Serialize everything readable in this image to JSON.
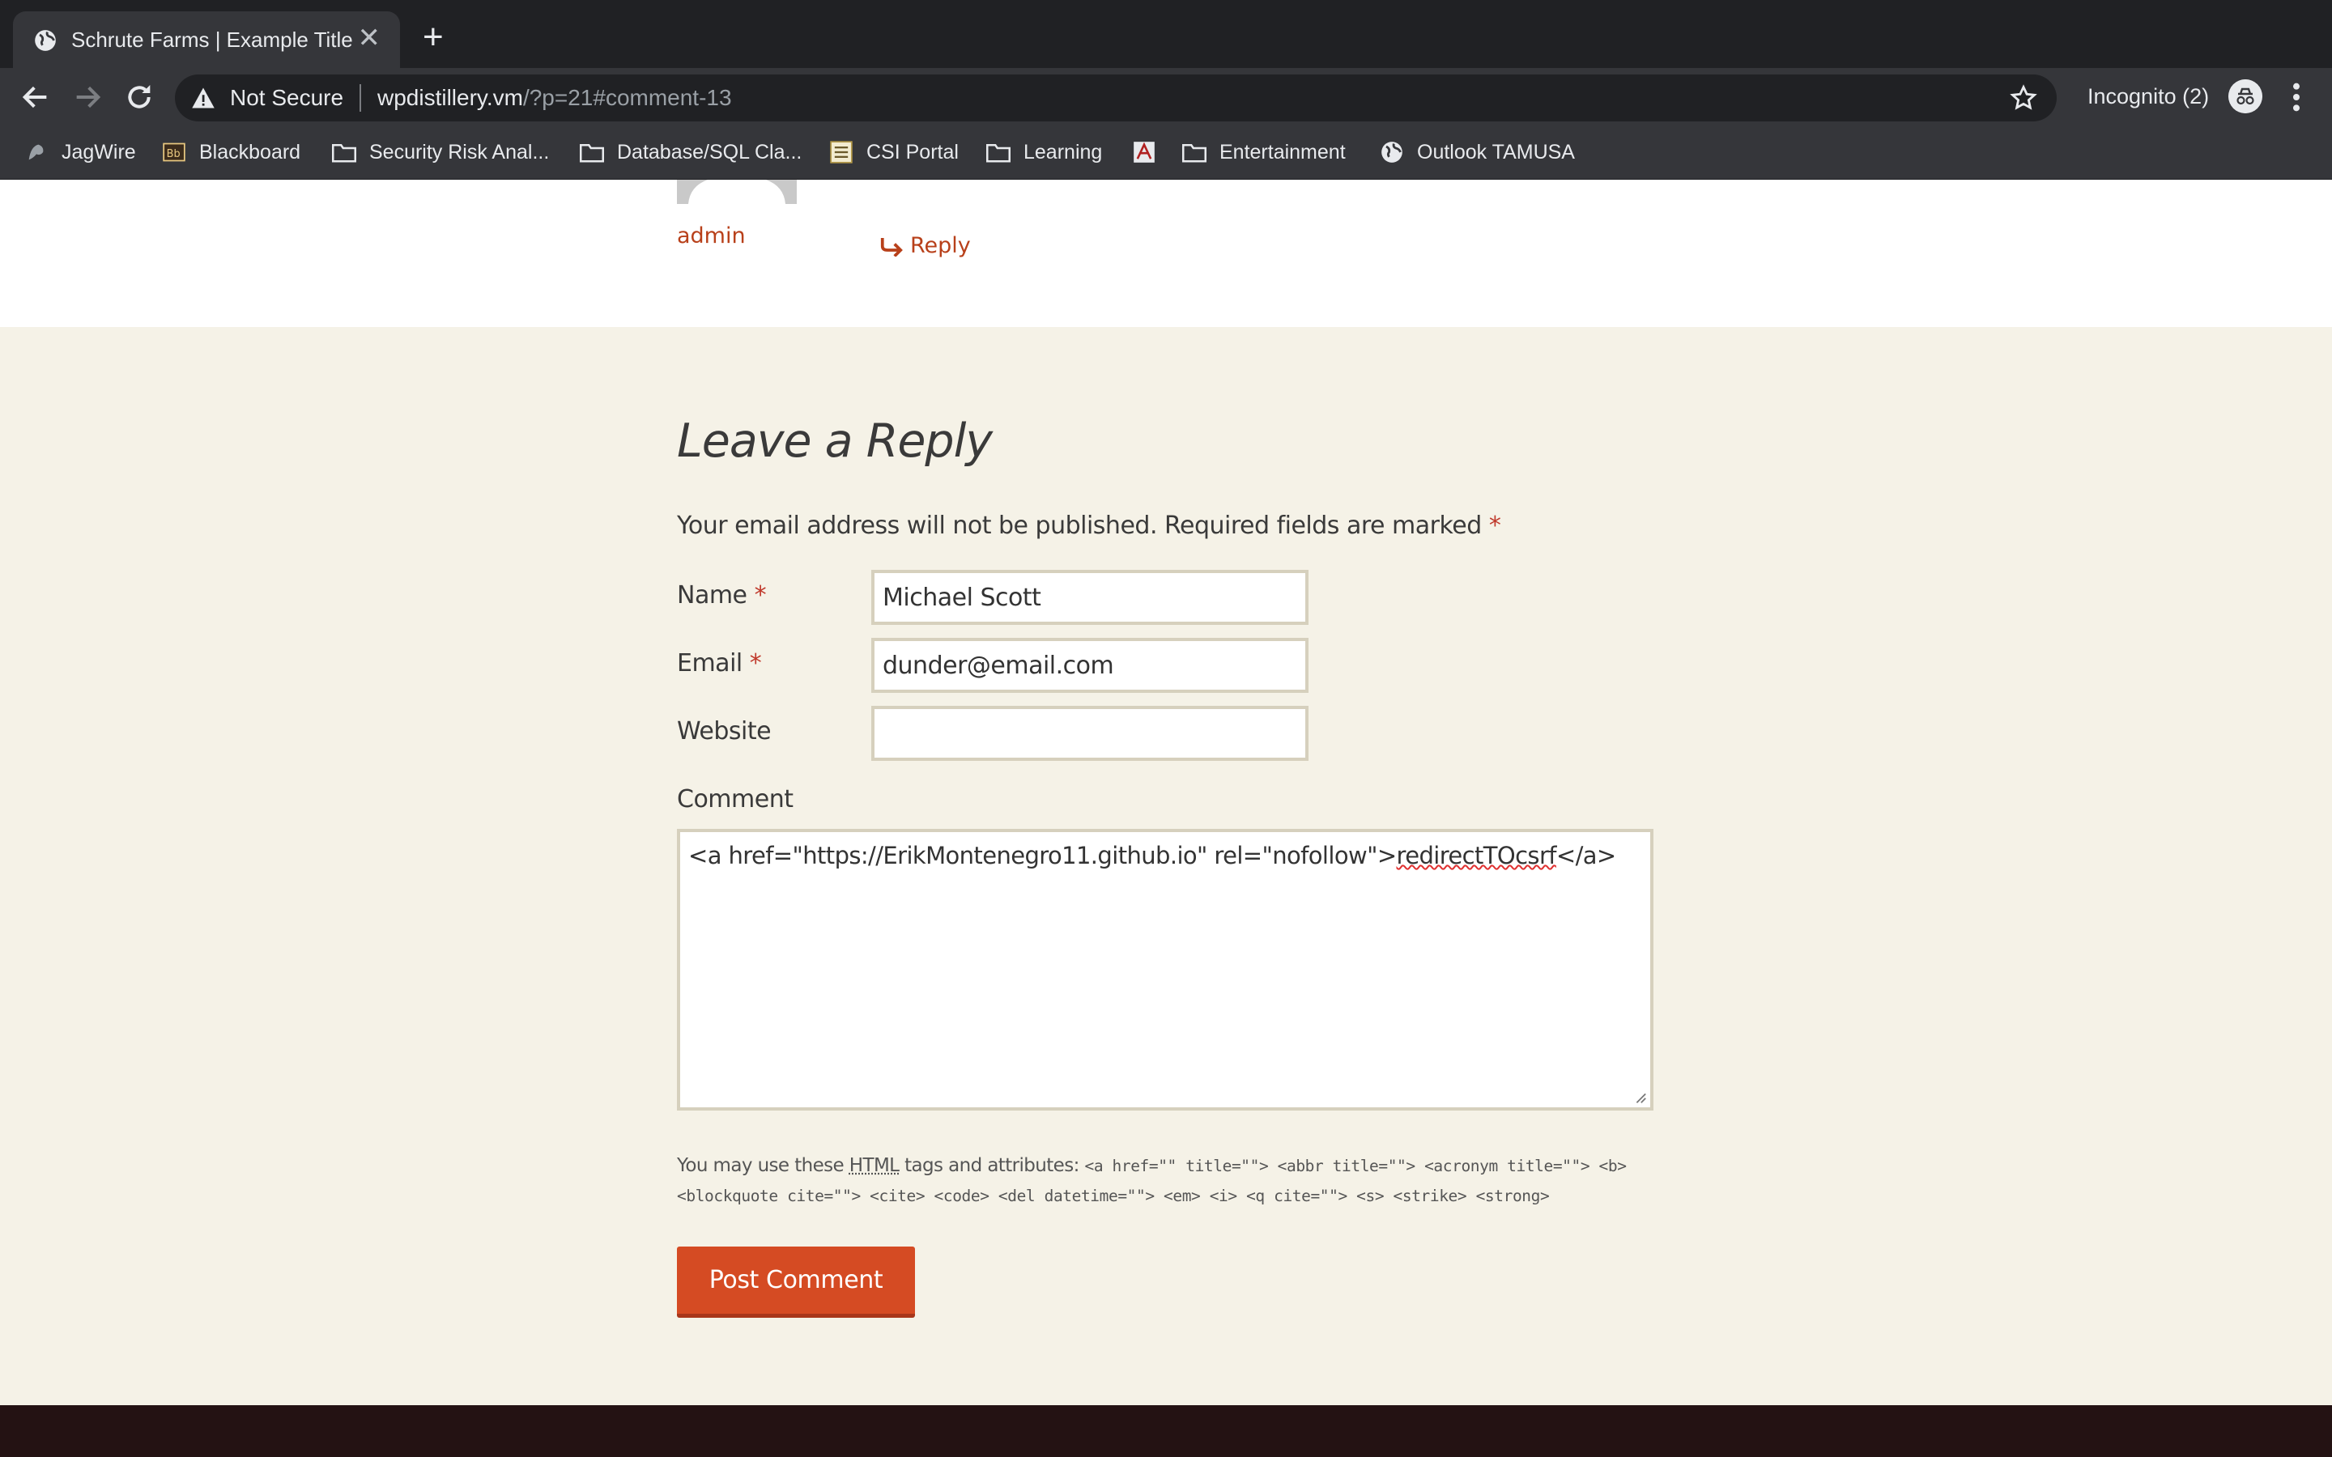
{
  "browser": {
    "tab_title": "Schrute Farms | Example Title",
    "security_label": "Not Secure",
    "url_host": "wpdistillery.vm",
    "url_path": "/?p=21#comment-13",
    "profile_label": "Incognito (2)"
  },
  "bookmarks": [
    {
      "label": "JagWire",
      "icon": "jaguar-icon"
    },
    {
      "label": "Blackboard",
      "icon": "blackboard-icon"
    },
    {
      "label": "Security Risk Anal...",
      "icon": "folder-icon"
    },
    {
      "label": "Database/SQL Cla...",
      "icon": "folder-icon"
    },
    {
      "label": "CSI Portal",
      "icon": "csi-icon"
    },
    {
      "label": "Learning",
      "icon": "folder-icon"
    },
    {
      "label": "",
      "icon": "pdf-app-icon"
    },
    {
      "label": "Entertainment",
      "icon": "folder-icon"
    },
    {
      "label": "Outlook TAMUSA",
      "icon": "globe-icon"
    }
  ],
  "comment": {
    "author": "admin",
    "reply_label": "Reply"
  },
  "reply_form": {
    "title": "Leave a Reply",
    "notes": "Your email address will not be published. Required fields are marked",
    "required_mark": "*",
    "name_label": "Name",
    "name_value": "Michael Scott",
    "email_label": "Email",
    "email_value": "dunder@email.com",
    "website_label": "Website",
    "website_value": "",
    "comment_label": "Comment",
    "comment_prefix": "<a href=\"https://ErikMontenegro11.github.io\" rel=\"nofollow\">",
    "comment_misspelled": "redirectTOcsrf",
    "comment_suffix": "</a>",
    "allowed_intro": "You may use these",
    "allowed_abbr": "HTML",
    "allowed_mid": "tags and attributes:",
    "allowed_tags": "<a href=\"\" title=\"\"> <abbr title=\"\"> <acronym title=\"\"> <b> <blockquote cite=\"\"> <cite> <code> <del datetime=\"\"> <em> <i> <q cite=\"\"> <s> <strike> <strong>",
    "submit_label": "Post Comment"
  },
  "colors": {
    "accent": "#b8401a",
    "button": "#d54b23",
    "page_bg": "#f5f2e7",
    "footer_bg": "#241213"
  }
}
